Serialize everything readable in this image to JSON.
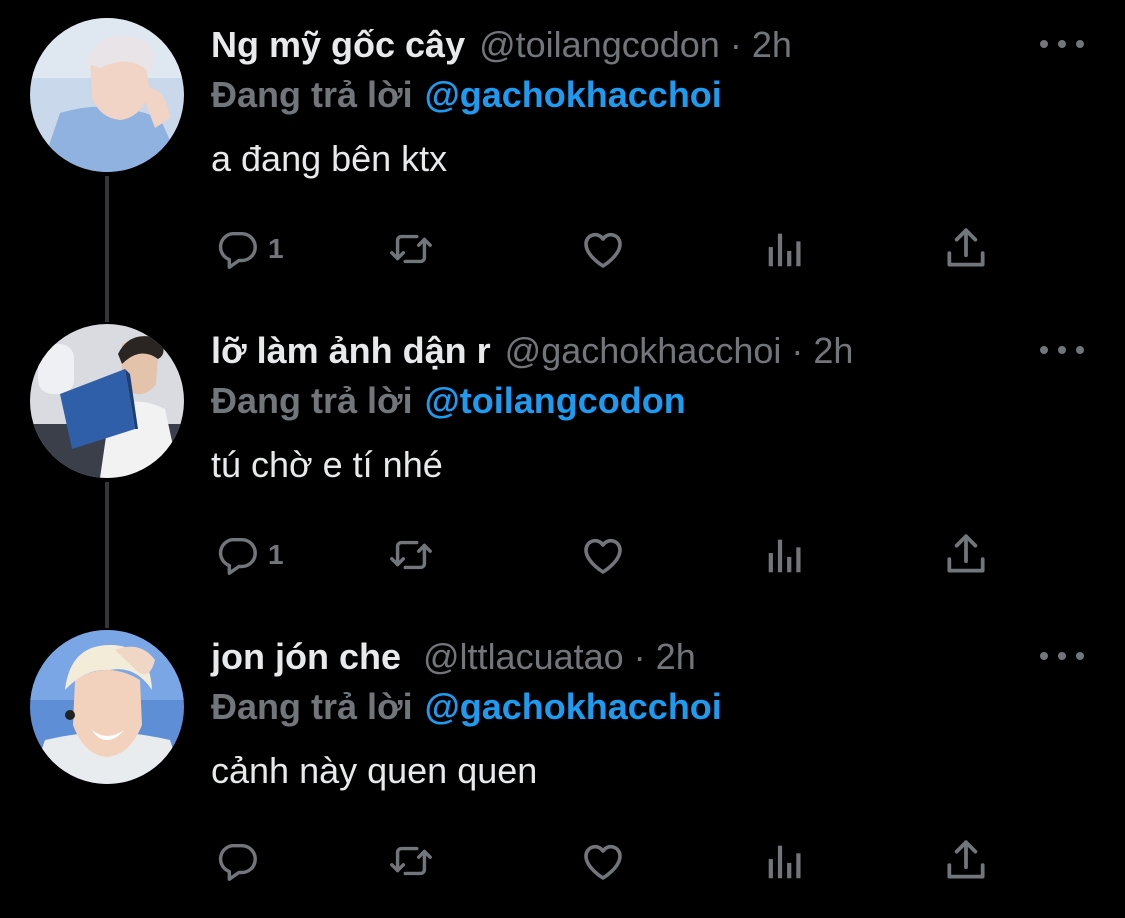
{
  "tweets": [
    {
      "display_name": "Ng mỹ gốc cây",
      "handle": "@toilangcodon",
      "separator": "·",
      "time": "2h",
      "reply_prefix": "Đang trả lời",
      "reply_to": "@gachokhacchoi",
      "text": "a đang bên ktx",
      "reply_count": "1",
      "avatar_colors": {
        "bg": "#c9d8ea",
        "shirt": "#8fb2e0",
        "skin": "#f1d4c6",
        "hair": "#e9e4e8"
      }
    },
    {
      "display_name": "lỡ làm ảnh dận r",
      "handle": "@gachokhacchoi",
      "separator": "·",
      "time": "2h",
      "reply_prefix": "Đang trả lời",
      "reply_to": "@toilangcodon",
      "text": "tú chờ e tí nhé",
      "reply_count": "1",
      "avatar_colors": {
        "bg": "#d9dbe0",
        "shirt": "#f2f2f2",
        "skin": "#e4c3ab",
        "hair": "#2a2522",
        "book": "#2f5fa8"
      }
    },
    {
      "display_name": "jon jón che",
      "handle": "@lttlacuatao",
      "separator": "·",
      "time": "2h",
      "reply_prefix": "Đang trả lời",
      "reply_to": "@gachokhacchoi",
      "text": "cảnh này quen quen",
      "reply_count": "",
      "avatar_colors": {
        "bg": "#5e8fd6",
        "shirt": "#e9ecef",
        "skin": "#f3d2bd",
        "hair": "#f3ecd9"
      }
    }
  ],
  "icons": {
    "reply": "reply-icon",
    "retweet": "retweet-icon",
    "like": "heart-icon",
    "stats": "analytics-icon",
    "share": "share-icon",
    "more": "more-icon"
  },
  "colors": {
    "background": "#000000",
    "text_primary": "#e7e9ea",
    "text_secondary": "#71767b",
    "accent": "#1d9bf0",
    "thread_line": "#333639"
  }
}
